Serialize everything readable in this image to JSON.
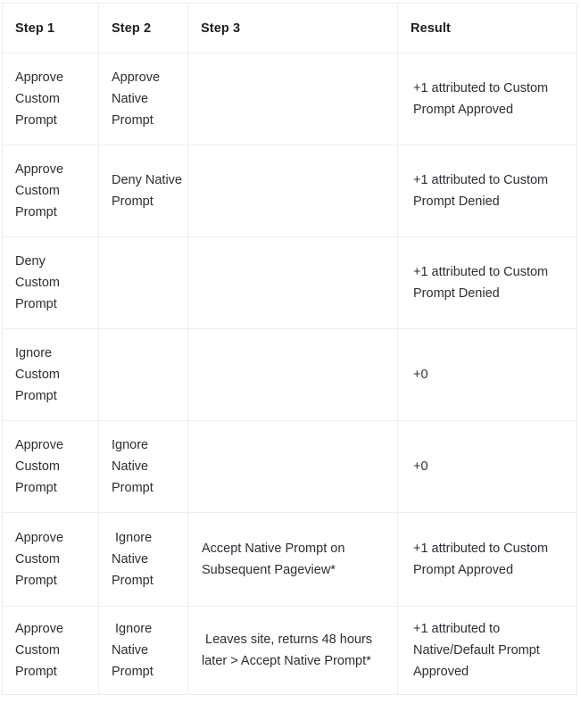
{
  "table": {
    "columns": [
      {
        "key": "step1",
        "label": "Step 1"
      },
      {
        "key": "step2",
        "label": "Step 2"
      },
      {
        "key": "step3",
        "label": "Step 3"
      },
      {
        "key": "result",
        "label": "Result"
      }
    ],
    "rows": [
      {
        "step1": "Approve Custom Prompt",
        "step2": "Approve Native Prompt",
        "step3": "",
        "result": "+1 attributed to Custom Prompt Approved"
      },
      {
        "step1": "Approve Custom Prompt",
        "step2": "Deny Native Prompt",
        "step3": "",
        "result": "+1 attributed to Custom Prompt Denied"
      },
      {
        "step1": "Deny Custom Prompt",
        "step2": "",
        "step3": "",
        "result": "+1 attributed to Custom Prompt Denied"
      },
      {
        "step1": "Ignore Custom Prompt",
        "step2": "",
        "step3": "",
        "result": "+0"
      },
      {
        "step1": "Approve Custom Prompt",
        "step2": "Ignore Native Prompt",
        "step3": "",
        "result": "+0"
      },
      {
        "step1": "Approve Custom Prompt",
        "step2": " Ignore Native Prompt",
        "step3": "Accept Native Prompt on Subsequent Pageview*",
        "result": "+1 attributed to Custom Prompt Approved"
      },
      {
        "step1": "Approve Custom Prompt",
        "step2": " Ignore Native Prompt",
        "step3": " Leaves site, returns 48 hours later > Accept Native Prompt*",
        "result": "+1 attributed to Native/Default Prompt Approved"
      }
    ]
  },
  "style": {
    "border_color": "#eceded",
    "header_text_color": "#1c1e21",
    "body_text_color": "#2b2f33",
    "background": "#ffffff"
  }
}
